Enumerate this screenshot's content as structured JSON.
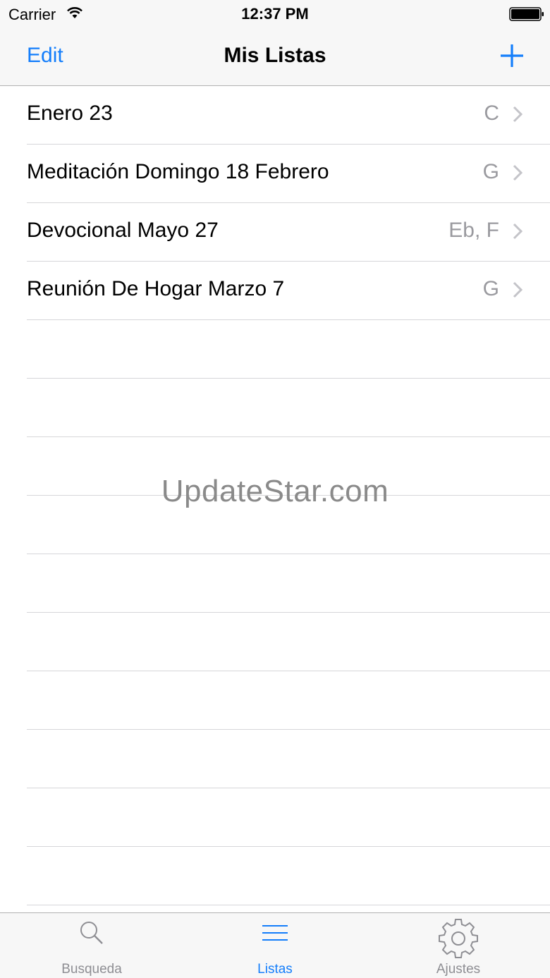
{
  "status_bar": {
    "carrier": "Carrier",
    "time": "12:37 PM"
  },
  "nav": {
    "edit_label": "Edit",
    "title": "Mis Listas",
    "add_icon": "plus-icon"
  },
  "lists": [
    {
      "name": "Enero 23",
      "key": "C"
    },
    {
      "name": "Meditación Domingo 18 Febrero",
      "key": "G"
    },
    {
      "name": "Devocional Mayo 27",
      "key": "Eb, F"
    },
    {
      "name": "Reunión De Hogar Marzo 7",
      "key": "G"
    }
  ],
  "watermark": "UpdateStar.com",
  "tabs": [
    {
      "label": "Busqueda",
      "icon": "search-icon",
      "active": false
    },
    {
      "label": "Listas",
      "icon": "list-icon",
      "active": true
    },
    {
      "label": "Ajustes",
      "icon": "gear-icon",
      "active": false
    }
  ],
  "colors": {
    "accent": "#147efb",
    "secondary_text": "#9a9a9f",
    "inactive_tab": "#8e8e93"
  }
}
